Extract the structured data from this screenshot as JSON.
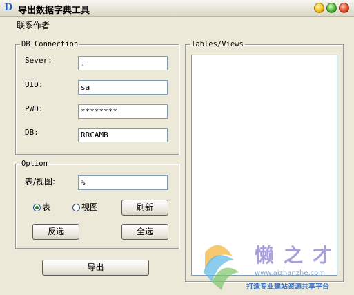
{
  "window": {
    "title": "导出数据字典工具"
  },
  "menu": {
    "contact_author": "联系作者"
  },
  "db_connection": {
    "legend": "DB Connection",
    "server_label": "Sever:",
    "server_value": ".",
    "uid_label": "UID:",
    "uid_value": "sa",
    "pwd_label": "PWD:",
    "pwd_value": "********",
    "db_label": "DB:",
    "db_value": "RRCAMB"
  },
  "option": {
    "legend": "Option",
    "table_view_label": "表/视图:",
    "filter_value": "%",
    "radio_table": "表",
    "radio_view": "视图",
    "selected": "table",
    "refresh_button": "刷新",
    "invert_button": "反选",
    "select_all_button": "全选"
  },
  "export_button": "导出",
  "tables_views": {
    "legend": "Tables/Views"
  },
  "watermark": {
    "brand": "懒之才",
    "url": "www.aizhanzhe.com",
    "slogan": "打造专业建站资源共享平台"
  }
}
